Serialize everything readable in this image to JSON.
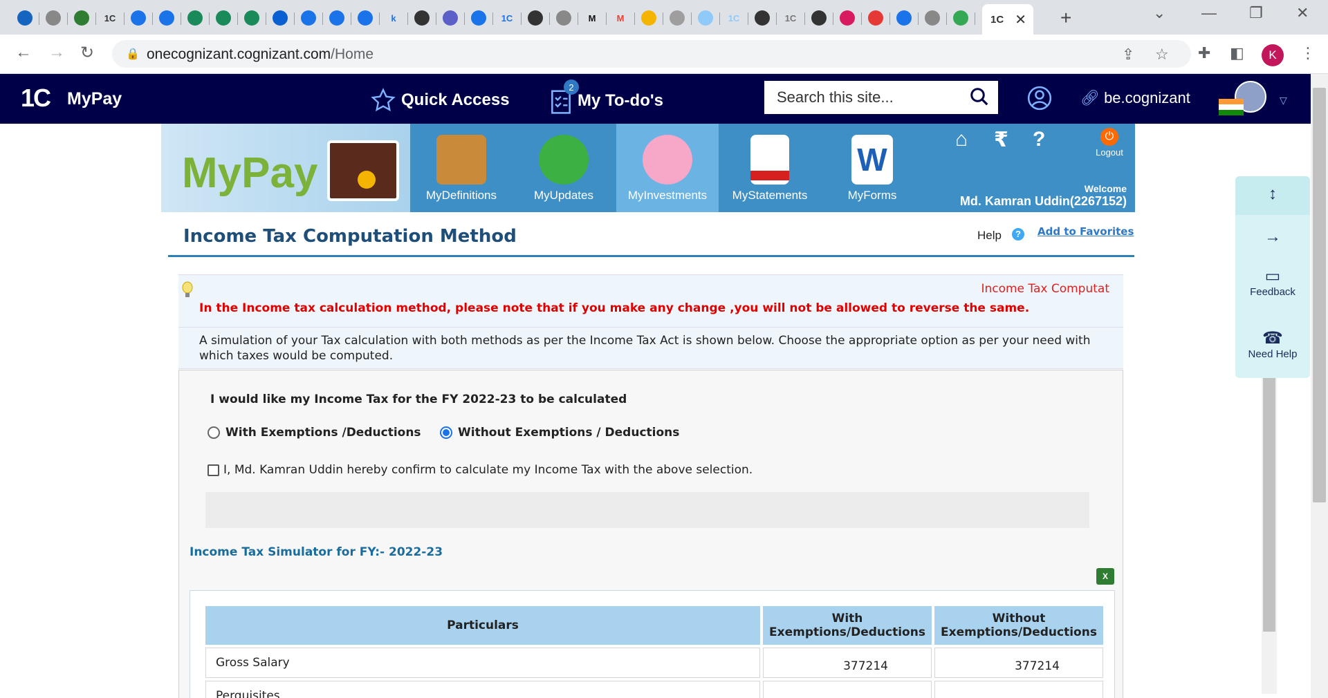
{
  "browser": {
    "tabs": [
      "",
      "",
      "",
      "1C",
      "",
      "",
      "",
      "",
      "",
      "",
      "",
      "",
      "",
      "k",
      "",
      "",
      "",
      "1C",
      "",
      "",
      "M",
      "M",
      "",
      "",
      "",
      "1C",
      "",
      "1C",
      "",
      "",
      "",
      "",
      "",
      "",
      "1C"
    ],
    "new_tab": "+",
    "url_host": "onecognizant.cognizant.com",
    "url_path": "/Home",
    "profile_initial": "K"
  },
  "header": {
    "logo": "1C",
    "app_name": "MyPay",
    "quick_access": "Quick Access",
    "todo": "My To-do's",
    "todo_count": "2",
    "search_placeholder": "Search this site...",
    "becognizant": "be.cognizant"
  },
  "banner": {
    "brand": "MyPay",
    "items": [
      {
        "label": "MyDefinitions"
      },
      {
        "label": "MyUpdates"
      },
      {
        "label": "MyInvestments"
      },
      {
        "label": "MyStatements"
      },
      {
        "label": "MyForms"
      }
    ],
    "logout": "Logout",
    "welcome": "Welcome",
    "user": "Md. Kamran Uddin(2267152)"
  },
  "page": {
    "title": "Income Tax Computation Method",
    "help": "Help",
    "add_favorites": "Add to Favorites",
    "marquee": "Income Tax Computat",
    "warning": "In the Income tax calculation method, please note that if you make any change ,you will not be allowed to reverse the same.",
    "info": "A simulation of your Tax calculation with both methods as per the Income Tax Act is shown below. Choose the appropriate option as per your need with which taxes would be computed.",
    "question": "I would like my Income Tax for the FY 2022-23 to be calculated",
    "option_with": "With Exemptions /Deductions",
    "option_without": "Without Exemptions / Deductions",
    "confirm": "I, Md. Kamran Uddin  hereby confirm to calculate my Income Tax with the above selection.",
    "sim_title": "Income Tax Simulator for FY:- 2022-23"
  },
  "table": {
    "headers": [
      "Particulars",
      "With Exemptions/Deductions",
      "Without Exemptions/Deductions"
    ],
    "rows": [
      {
        "label": "Gross Salary",
        "with": "377214",
        "without": "377214"
      },
      {
        "label": "Perquisites",
        "with": "-",
        "without": "-"
      }
    ]
  },
  "widget": {
    "feedback": "Feedback",
    "need_help": "Need Help"
  }
}
